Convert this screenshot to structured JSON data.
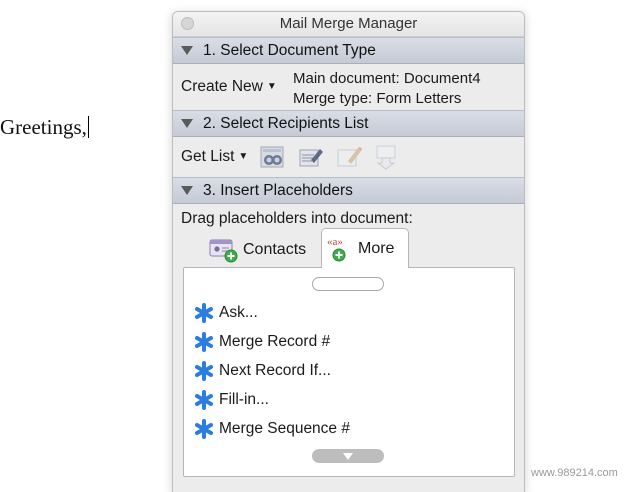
{
  "document": {
    "text": "Greetings,"
  },
  "panel": {
    "title": "Mail Merge Manager",
    "section1": {
      "header": "1. Select Document Type",
      "create_button": "Create New",
      "main_document": "Main document: Document4",
      "merge_type": "Merge type: Form Letters"
    },
    "section2": {
      "header": "2. Select Recipients List",
      "get_list_button": "Get List",
      "tool_icons": [
        "find-recipient-icon",
        "edit-list-icon",
        "edit-data-source-icon",
        "filter-recipients-icon"
      ]
    },
    "section3": {
      "header": "3. Insert Placeholders",
      "instruction": "Drag placeholders into document:",
      "tabs": [
        {
          "label": "Contacts",
          "selected": false
        },
        {
          "label": "More",
          "selected": true
        }
      ],
      "items": [
        {
          "label": "Ask..."
        },
        {
          "label": "Merge Record #"
        },
        {
          "label": "Next Record If..."
        },
        {
          "label": "Fill-in..."
        },
        {
          "label": "Merge Sequence #"
        }
      ]
    }
  },
  "watermark": "www.989214.com",
  "colors": {
    "header_bg": "#c9ced9",
    "panel_bg": "#ececec",
    "star_icon": "#2b7de0"
  }
}
